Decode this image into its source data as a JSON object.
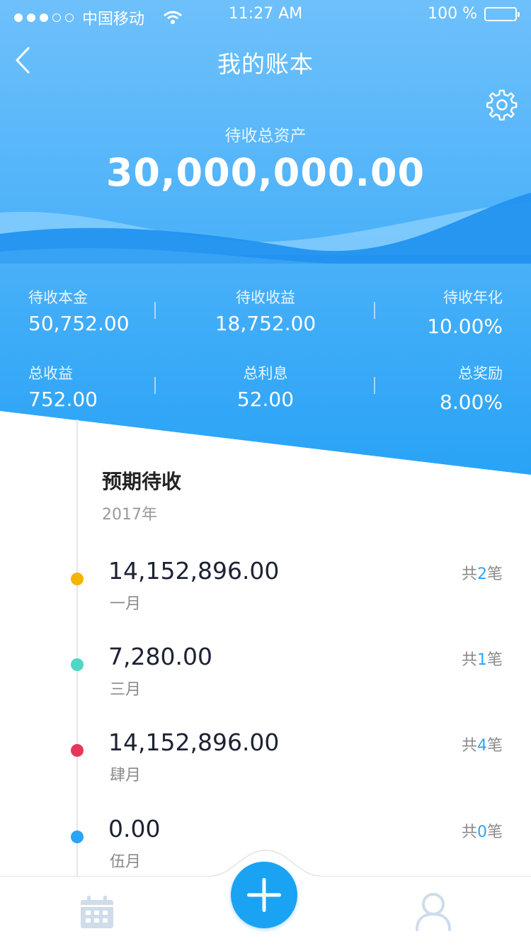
{
  "status_bar": {
    "carrier": "中国移动",
    "time": "11:27 AM",
    "battery_text": "100 %"
  },
  "nav": {
    "title": "我的账本",
    "back_icon": "chevron-left-icon",
    "settings_icon": "gear-icon"
  },
  "summary": {
    "label": "待收总资产",
    "value": "30,000,000.00"
  },
  "stats": [
    {
      "label": "待收本金",
      "value": "50,752.00"
    },
    {
      "label": "待收收益",
      "value": "18,752.00"
    },
    {
      "label": "待收年化",
      "value": "10.00%"
    },
    {
      "label": "总收益",
      "value": "752.00"
    },
    {
      "label": "总利息",
      "value": "52.00"
    },
    {
      "label": "总奖励",
      "value": "8.00%"
    }
  ],
  "timeline": {
    "title": "预期待收",
    "year": "2017年",
    "entries": [
      {
        "amount": "14,152,896.00",
        "month": "一月",
        "count_prefix": "共",
        "count": "2",
        "count_suffix": "笔",
        "color": "#f5b400"
      },
      {
        "amount": "7,280.00",
        "month": "三月",
        "count_prefix": "共",
        "count": "1",
        "count_suffix": "笔",
        "color": "#4fd6c6"
      },
      {
        "amount": "14,152,896.00",
        "month": "肆月",
        "count_prefix": "共",
        "count": "4",
        "count_suffix": "笔",
        "color": "#e8365a"
      },
      {
        "amount": "0.00",
        "month": "伍月",
        "count_prefix": "共",
        "count": "0",
        "count_suffix": "笔",
        "color": "#2aa5f5"
      }
    ]
  },
  "tabbar": {
    "left_icon": "calendar-icon",
    "center_icon": "plus-icon",
    "right_icon": "user-icon"
  },
  "colors": {
    "header_top": "#6ec0fb",
    "header_bottom": "#29a3f6",
    "accent": "#1aa3f2"
  }
}
